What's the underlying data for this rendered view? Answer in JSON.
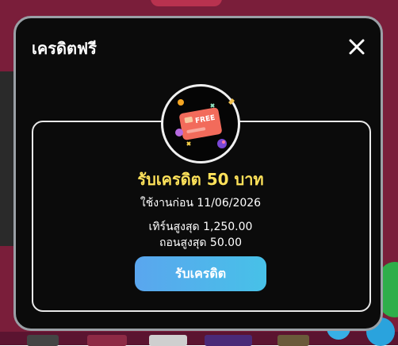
{
  "modal": {
    "title": "เครดิตฟรี",
    "close_icon": "close-icon"
  },
  "offer": {
    "emblem_icon": "free-credit-card-icon",
    "card_badge": "FREE",
    "title": "รับเครดิต 50 บาท",
    "expiry": "ใช้งานก่อน 11/06/2026",
    "max_turnover": "เทิร์นสูงสุด 1,250.00",
    "max_withdraw": "ถอนสูงสุด 50.00",
    "claim_button": "รับเครดิต"
  },
  "colors": {
    "backdrop": "#7a1e3a",
    "modal_bg": "#0b0b0b",
    "title_accent": "#ffe25a",
    "button_gradient_start": "#5aa6ee",
    "button_gradient_end": "#47c1e8"
  }
}
